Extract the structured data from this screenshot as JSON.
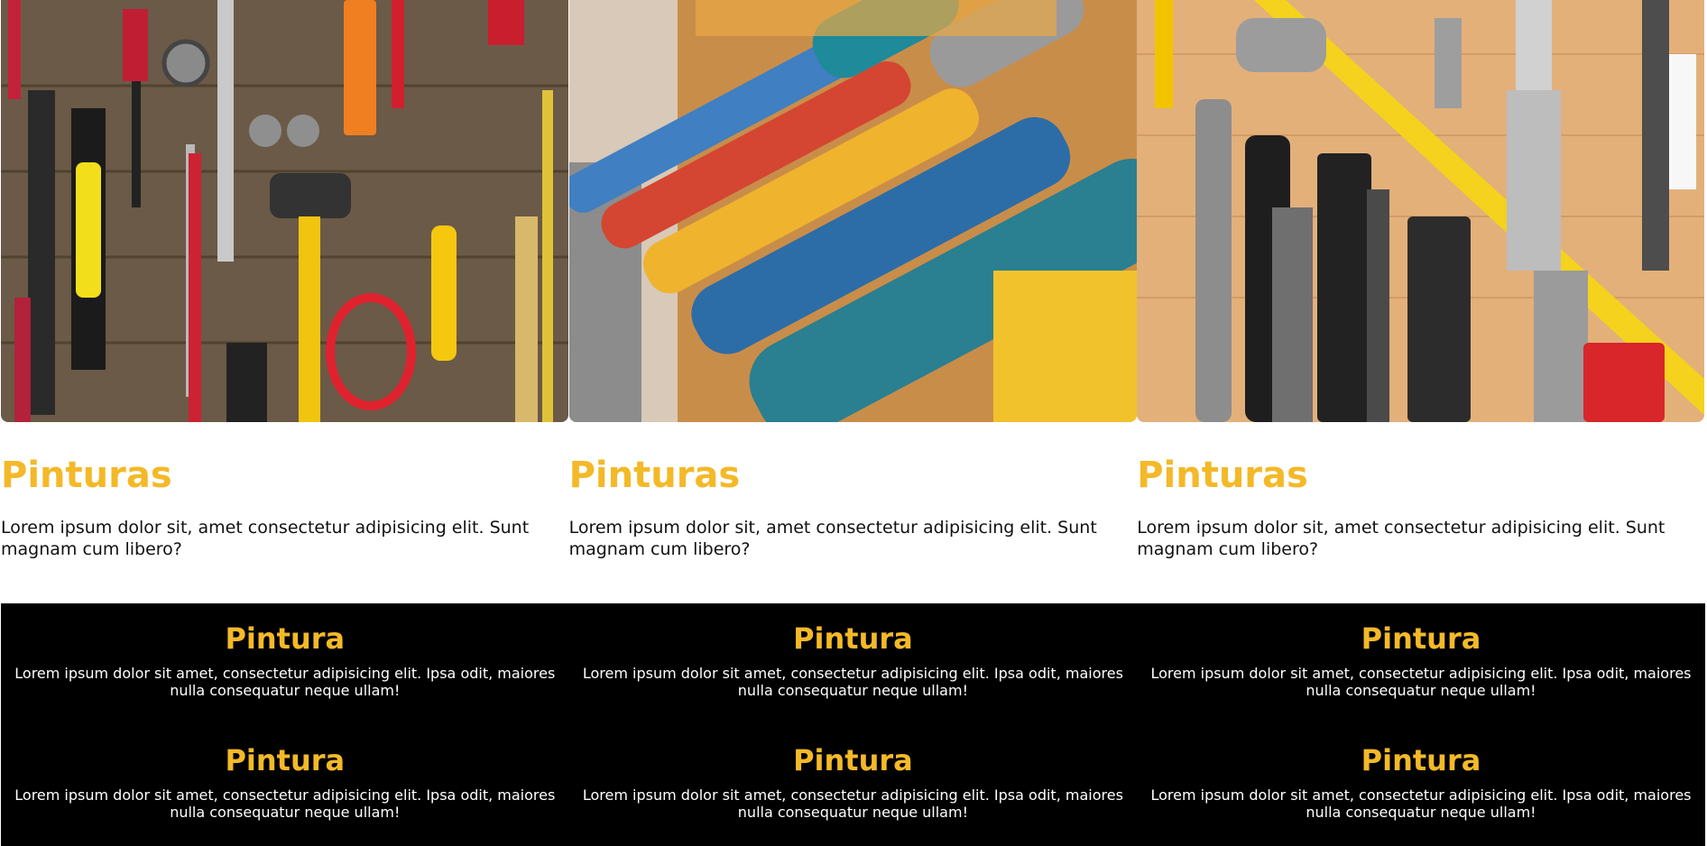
{
  "cards": [
    {
      "image_icon": "hand-tools-on-wood-photo",
      "title": "Pinturas",
      "text": "Lorem ipsum dolor sit, amet consectetur adipisicing elit. Sunt magnam cum libero?"
    },
    {
      "image_icon": "power-grinders-photo",
      "title": "Pinturas",
      "text": "Lorem ipsum dolor sit, amet consectetur adipisicing elit. Sunt magnam cum libero?"
    },
    {
      "image_icon": "tools-and-tape-measure-photo",
      "title": "Pinturas",
      "text": "Lorem ipsum dolor sit, amet consectetur adipisicing elit. Sunt magnam cum libero?"
    }
  ],
  "features": [
    {
      "title": "Pintura",
      "text": "Lorem ipsum dolor sit amet, consectetur adipisicing elit. Ipsa odit, maiores nulla consequatur neque ullam!"
    },
    {
      "title": "Pintura",
      "text": "Lorem ipsum dolor sit amet, consectetur adipisicing elit. Ipsa odit, maiores nulla consequatur neque ullam!"
    },
    {
      "title": "Pintura",
      "text": "Lorem ipsum dolor sit amet, consectetur adipisicing elit. Ipsa odit, maiores nulla consequatur neque ullam!"
    },
    {
      "title": "Pintura",
      "text": "Lorem ipsum dolor sit amet, consectetur adipisicing elit. Ipsa odit, maiores nulla consequatur neque ullam!"
    },
    {
      "title": "Pintura",
      "text": "Lorem ipsum dolor sit amet, consectetur adipisicing elit. Ipsa odit, maiores nulla consequatur neque ullam!"
    },
    {
      "title": "Pintura",
      "text": "Lorem ipsum dolor sit amet, consectetur adipisicing elit. Ipsa odit, maiores nulla consequatur neque ullam!"
    }
  ],
  "colors": {
    "accent": "#f4b928",
    "band_background": "#000000",
    "page_background": "#ffffff"
  }
}
